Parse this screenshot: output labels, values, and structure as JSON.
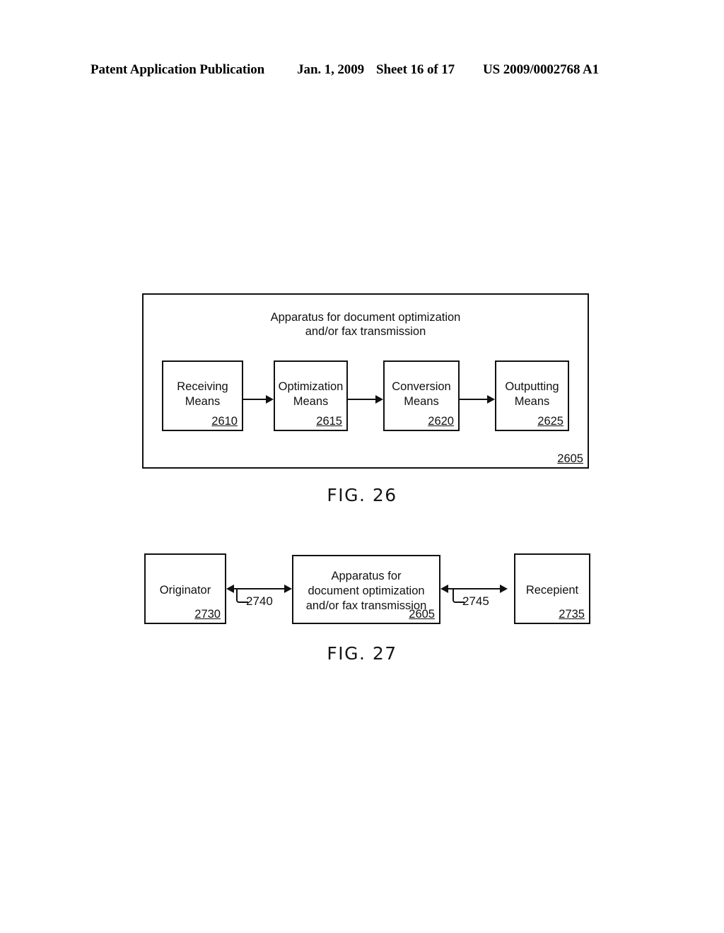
{
  "header": {
    "publication": "Patent Application Publication",
    "date": "Jan. 1, 2009",
    "sheet": "Sheet 16 of 17",
    "patent_number": "US 2009/0002768 A1"
  },
  "colors": {
    "ink": "#111111",
    "background": "#ffffff"
  },
  "figures": [
    {
      "caption": "FIG. 26",
      "outer_box": {
        "title_line1": "Apparatus for document optimization",
        "title_line2": "and/or fax transmission",
        "reference": "2605"
      },
      "blocks": [
        {
          "line1": "Receiving",
          "line2": "Means",
          "reference": "2610"
        },
        {
          "line1": "Optimization",
          "line2": "Means",
          "reference": "2615"
        },
        {
          "line1": "Conversion",
          "line2": "Means",
          "reference": "2620"
        },
        {
          "line1": "Outputting",
          "line2": "Means",
          "reference": "2625"
        }
      ],
      "connectors": [
        {
          "from": "2610",
          "to": "2615",
          "type": "single-arrow-right"
        },
        {
          "from": "2615",
          "to": "2620",
          "type": "single-arrow-right"
        },
        {
          "from": "2620",
          "to": "2625",
          "type": "single-arrow-right"
        }
      ]
    },
    {
      "caption": "FIG. 27",
      "blocks": [
        {
          "line1": "Originator",
          "reference": "2730"
        },
        {
          "line1": "Apparatus for",
          "line2": "document optimization",
          "line3": "and/or fax transmission",
          "reference": "2605"
        },
        {
          "line1": "Recepient",
          "reference": "2735"
        }
      ],
      "connectors": [
        {
          "between": "2730-2605",
          "label": "2740",
          "type": "double-arrow"
        },
        {
          "between": "2605-2735",
          "label": "2745",
          "type": "double-arrow"
        }
      ]
    }
  ]
}
